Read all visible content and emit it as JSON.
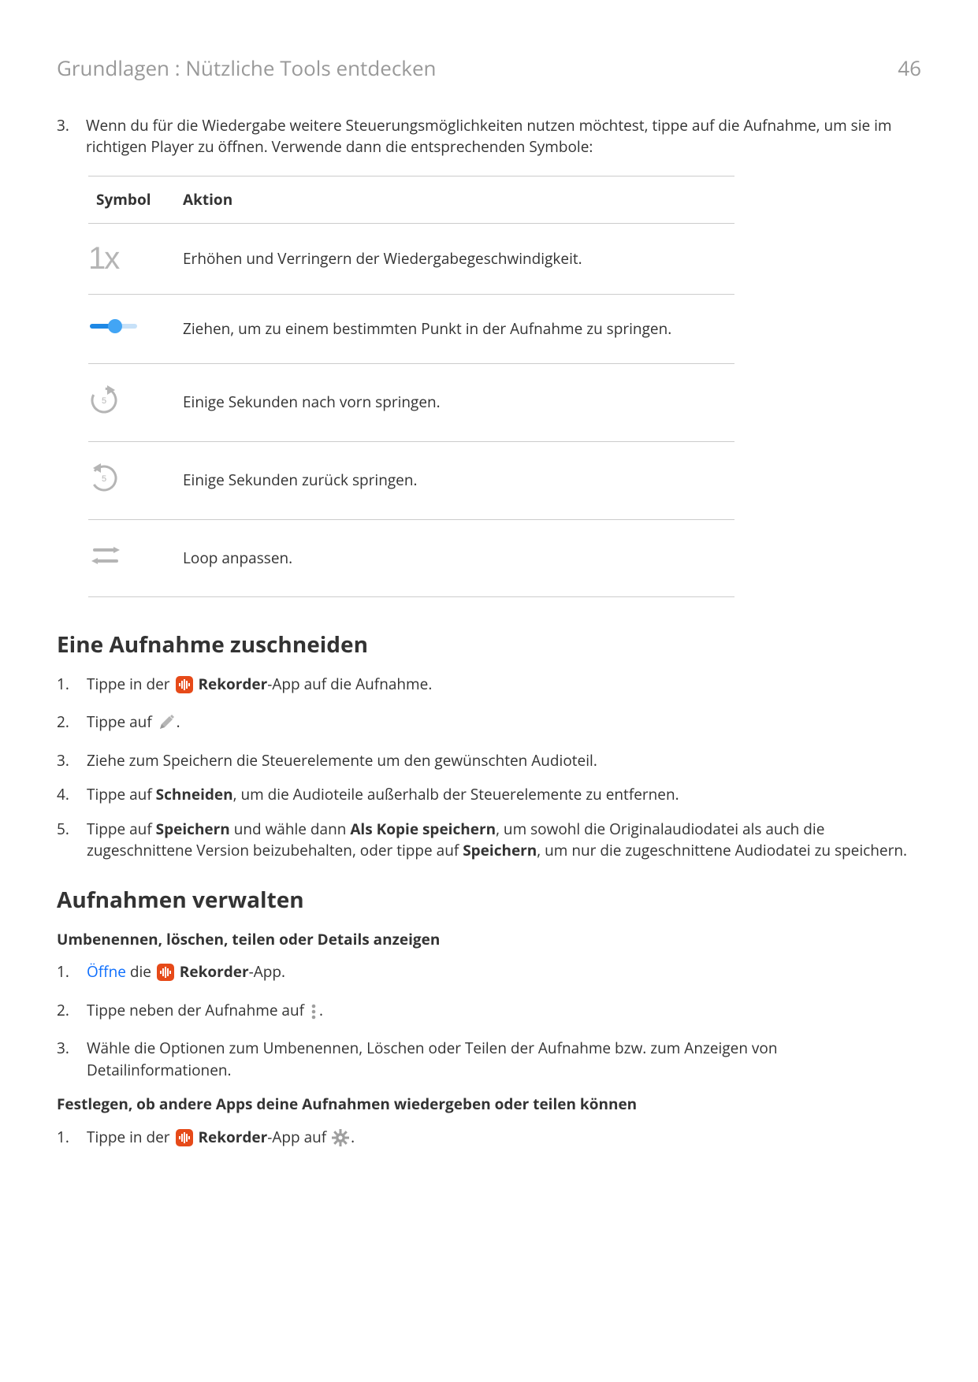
{
  "header": {
    "breadcrumb": "Grundlagen : Nützliche Tools entdecken",
    "page": "46"
  },
  "intro": {
    "num": "3.",
    "text": "Wenn du für die Wiedergabe weitere Steuerungsmöglichkeiten nutzen möchtest, tippe auf die Aufnahme, um sie im richtigen Player zu öffnen. Verwende dann die entsprechenden Symbole:"
  },
  "table": {
    "col1": "Symbol",
    "col2": "Aktion",
    "rows": [
      {
        "icon": "speed-1x",
        "action": "Erhöhen und Verringern der Wiedergabegeschwindigkeit."
      },
      {
        "icon": "slider",
        "action": "Ziehen, um zu einem bestimmten Punkt in der Aufnahme zu springen."
      },
      {
        "icon": "fwd5",
        "action": "Einige Sekunden nach vorn springen."
      },
      {
        "icon": "back5",
        "action": "Einige Sekunden zurück springen."
      },
      {
        "icon": "loop",
        "action": "Loop anpassen."
      }
    ]
  },
  "section1": {
    "heading": "Eine Aufnahme zuschneiden",
    "steps": [
      {
        "n": "1.",
        "pre": "Tippe in der ",
        "icon": "rekorder",
        "bold": "Rekorder",
        "post": "-App auf die Aufnahme."
      },
      {
        "n": "2.",
        "pre": "Tippe auf ",
        "icon": "pencil",
        "post": "."
      },
      {
        "n": "3.",
        "text": "Ziehe zum Speichern die Steuerelemente um den gewünschten Audioteil."
      },
      {
        "n": "4.",
        "pre": "Tippe auf ",
        "bold": "Schneiden",
        "post": ", um die Audioteile außerhalb der Steuerelemente zu entfernen."
      },
      {
        "n": "5.",
        "pre": "Tippe auf ",
        "bold": "Speichern",
        "mid": " und wähle dann ",
        "bold2": "Als Kopie speichern",
        "mid2": ", um sowohl die Originalaudiodatei als auch die zugeschnittene Version beizubehalten, oder tippe auf ",
        "bold3": "Speichern",
        "post": ", um nur die zugeschnittene Audiodatei zu speichern."
      }
    ]
  },
  "section2": {
    "heading": "Aufnahmen verwalten",
    "sub1": "Umbenennen, löschen, teilen oder Details anzeigen",
    "steps1": [
      {
        "n": "1.",
        "link": "Öffne",
        "mid": " die ",
        "icon": "rekorder",
        "bold": "Rekorder",
        "post": "-App."
      },
      {
        "n": "2.",
        "pre": "Tippe neben der Aufnahme auf ",
        "icon": "more",
        "post": "."
      },
      {
        "n": "3.",
        "text": "Wähle die Optionen zum Umbenennen, Löschen oder Teilen der Aufnahme bzw. zum Anzeigen von Detailinformationen."
      }
    ],
    "sub2": "Festlegen, ob andere Apps deine Aufnahmen wiedergeben oder teilen können",
    "steps2": [
      {
        "n": "1.",
        "pre": "Tippe in der ",
        "icon": "rekorder",
        "bold": "Rekorder",
        "mid": "-App auf ",
        "icon2": "gear",
        "post": "."
      }
    ]
  }
}
